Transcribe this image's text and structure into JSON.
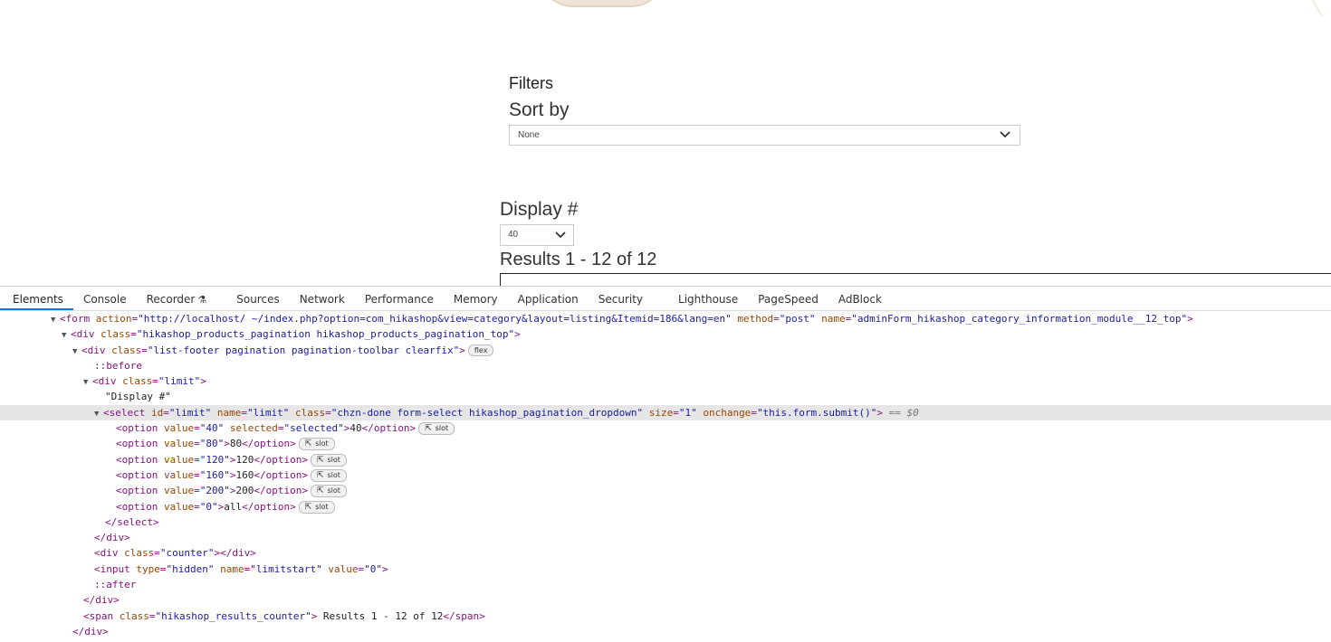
{
  "page": {
    "filters_title": "Filters",
    "sort_label": "Sort by",
    "sort_value": "None",
    "display_label": "Display #",
    "limit_value": "40",
    "results_text": "Results 1 - 12 of 12"
  },
  "devtools": {
    "tabs": [
      {
        "label": "Elements"
      },
      {
        "label": "Console"
      },
      {
        "label": "Recorder"
      },
      {
        "label": "Sources"
      },
      {
        "label": "Network"
      },
      {
        "label": "Performance"
      },
      {
        "label": "Memory"
      },
      {
        "label": "Application"
      },
      {
        "label": "Security"
      },
      {
        "label": "Lighthouse"
      },
      {
        "label": "PageSpeed"
      },
      {
        "label": "AdBlock"
      }
    ],
    "active_tab": "Elements",
    "badges": {
      "flex": "flex",
      "slot": "slot"
    },
    "dom": {
      "form_action": "\"http://localhost/      ~/index.php?option=com_hikashop&view=category&layout=listing&Itemid=186&lang=en\"",
      "form_method": "\"post\"",
      "form_name": "\"adminForm_hikashop_category_information_module__12_top\"",
      "div1_class": "\"hikashop_products_pagination hikashop_products_pagination_top\"",
      "div2_class": "\"list-footer pagination pagination-toolbar clearfix\"",
      "before": "::before",
      "limit_div_class": "\"limit\"",
      "display_text": "\"Display #\"",
      "select_id": "\"limit\"",
      "select_name": "\"limit\"",
      "select_class": "\"chzn-done form-select hikashop_pagination_dropdown\"",
      "select_size": "\"1\"",
      "select_onchange": "\"this.form.submit()\"",
      "selected_marker": "== $0",
      "options": [
        {
          "value": "\"40\"",
          "extra_attr": "selected",
          "extra_val": "\"selected\"",
          "text": "40"
        },
        {
          "value": "\"80\"",
          "text": "80"
        },
        {
          "value": "\"120\"",
          "text": "120"
        },
        {
          "value": "\"160\"",
          "text": "160"
        },
        {
          "value": "\"200\"",
          "text": "200"
        },
        {
          "value": "\"0\"",
          "text": "all"
        }
      ],
      "counter_class": "\"counter\"",
      "input_type": "\"hidden\"",
      "input_name": "\"limitstart\"",
      "input_value": "\"0\"",
      "after": "::after",
      "span_class": "\"hikashop_results_counter\"",
      "span_text": " Results 1 - 12 of 12"
    }
  }
}
